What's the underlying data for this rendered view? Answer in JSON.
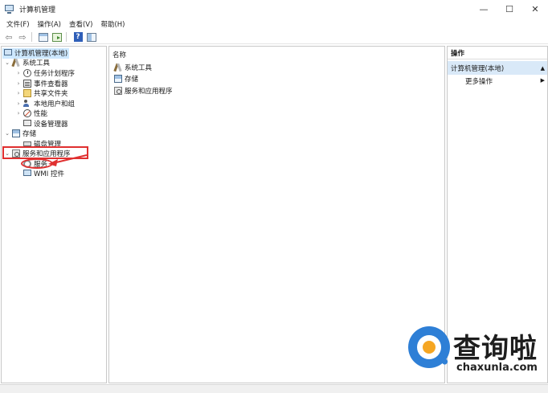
{
  "window": {
    "title": "计算机管理",
    "minimize": "—",
    "maximize": "☐",
    "close": "✕"
  },
  "menu": [
    "文件(F)",
    "操作(A)",
    "查看(V)",
    "帮助(H)"
  ],
  "toolbar": {
    "back": "⇦",
    "forward": "⇨",
    "help": "?"
  },
  "tree": {
    "root": "计算机管理(本地)",
    "items": [
      {
        "label": "系统工具",
        "icon": "tools-icon",
        "toggle": "⌄"
      },
      {
        "label": "任务计划程序",
        "icon": "clock-icon",
        "toggle": "›"
      },
      {
        "label": "事件查看器",
        "icon": "event-viewer-icon",
        "toggle": "›"
      },
      {
        "label": "共享文件夹",
        "icon": "shared-folder-icon",
        "toggle": "›"
      },
      {
        "label": "本地用户和组",
        "icon": "users-icon",
        "toggle": "›"
      },
      {
        "label": "性能",
        "icon": "performance-icon",
        "toggle": "›"
      },
      {
        "label": "设备管理器",
        "icon": "device-manager-icon",
        "toggle": ""
      },
      {
        "label": "存储",
        "icon": "storage-icon",
        "toggle": "⌄"
      },
      {
        "label": "磁盘管理",
        "icon": "disk-icon",
        "toggle": ""
      },
      {
        "label": "服务和应用程序",
        "icon": "services-apps-icon",
        "toggle": "⌄"
      },
      {
        "label": "服务",
        "icon": "gear-icon",
        "toggle": ""
      },
      {
        "label": "WMI 控件",
        "icon": "wmi-icon",
        "toggle": ""
      }
    ]
  },
  "middle": {
    "column_header": "名称",
    "rows": [
      "系统工具",
      "存储",
      "服务和应用程序"
    ]
  },
  "actions": {
    "header": "操作",
    "section": "计算机管理(本地)",
    "section_arrow": "▲",
    "more": "更多操作",
    "more_arrow": "▶"
  },
  "watermark": {
    "title": "查询啦",
    "url": "chaxunla.com"
  },
  "colors": {
    "annotation": "#e03030",
    "selection": "#cde8ff",
    "actions_section_bg": "#d9e9f8",
    "watermark_blue": "#2e7fd6",
    "watermark_orange": "#f5a623"
  }
}
